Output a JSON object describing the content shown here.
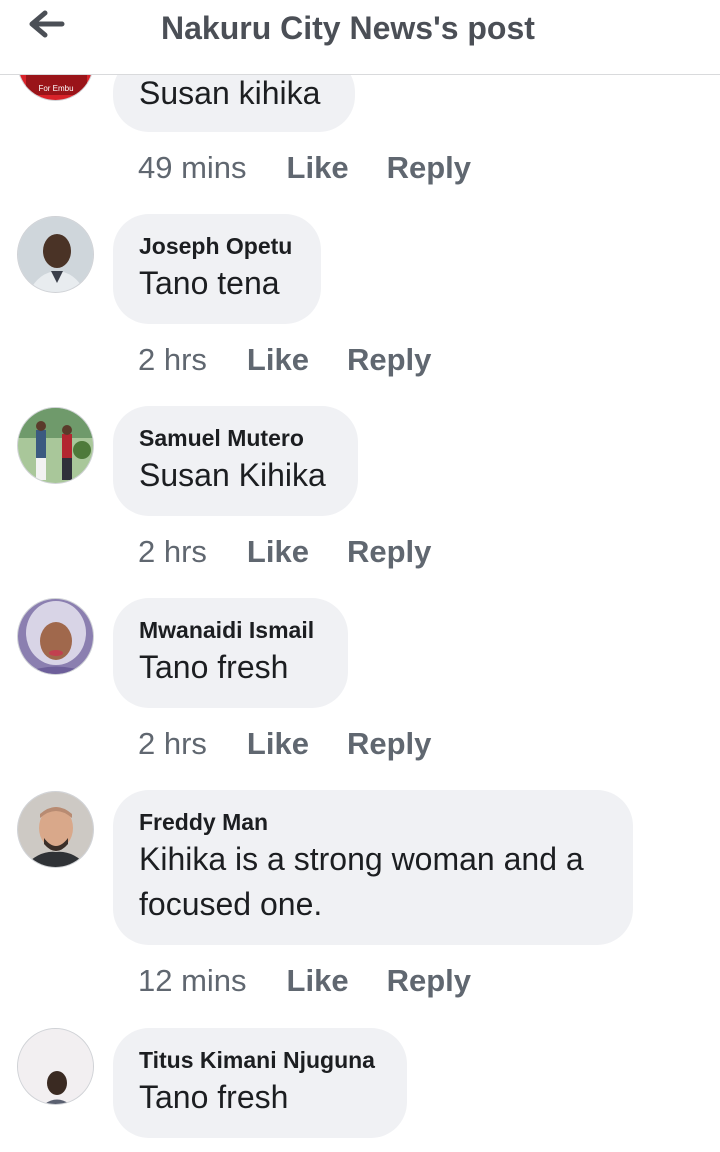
{
  "header": {
    "title": "Nakuru City News's post",
    "back_icon": "arrow-left-icon"
  },
  "actions": {
    "like": "Like",
    "reply": "Reply"
  },
  "comments": [
    {
      "author": "",
      "text": "Susan kihika",
      "time": "49 mins"
    },
    {
      "author": "Joseph Opetu",
      "text": "Tano tena",
      "time": "2 hrs"
    },
    {
      "author": "Samuel Mutero",
      "text": "Susan Kihika",
      "time": "2 hrs"
    },
    {
      "author": "Mwanaidi Ismail",
      "text": "Tano fresh",
      "time": "2 hrs"
    },
    {
      "author": "Freddy Man",
      "text": "Kihika is a strong woman and a focused one.",
      "time": "12 mins"
    },
    {
      "author": "Titus Kimani Njuguna",
      "text": "Tano fresh",
      "time": ""
    }
  ],
  "colors": {
    "bubble": "#f0f1f4",
    "meta_text": "#606770",
    "title_text": "#4b4f56"
  }
}
